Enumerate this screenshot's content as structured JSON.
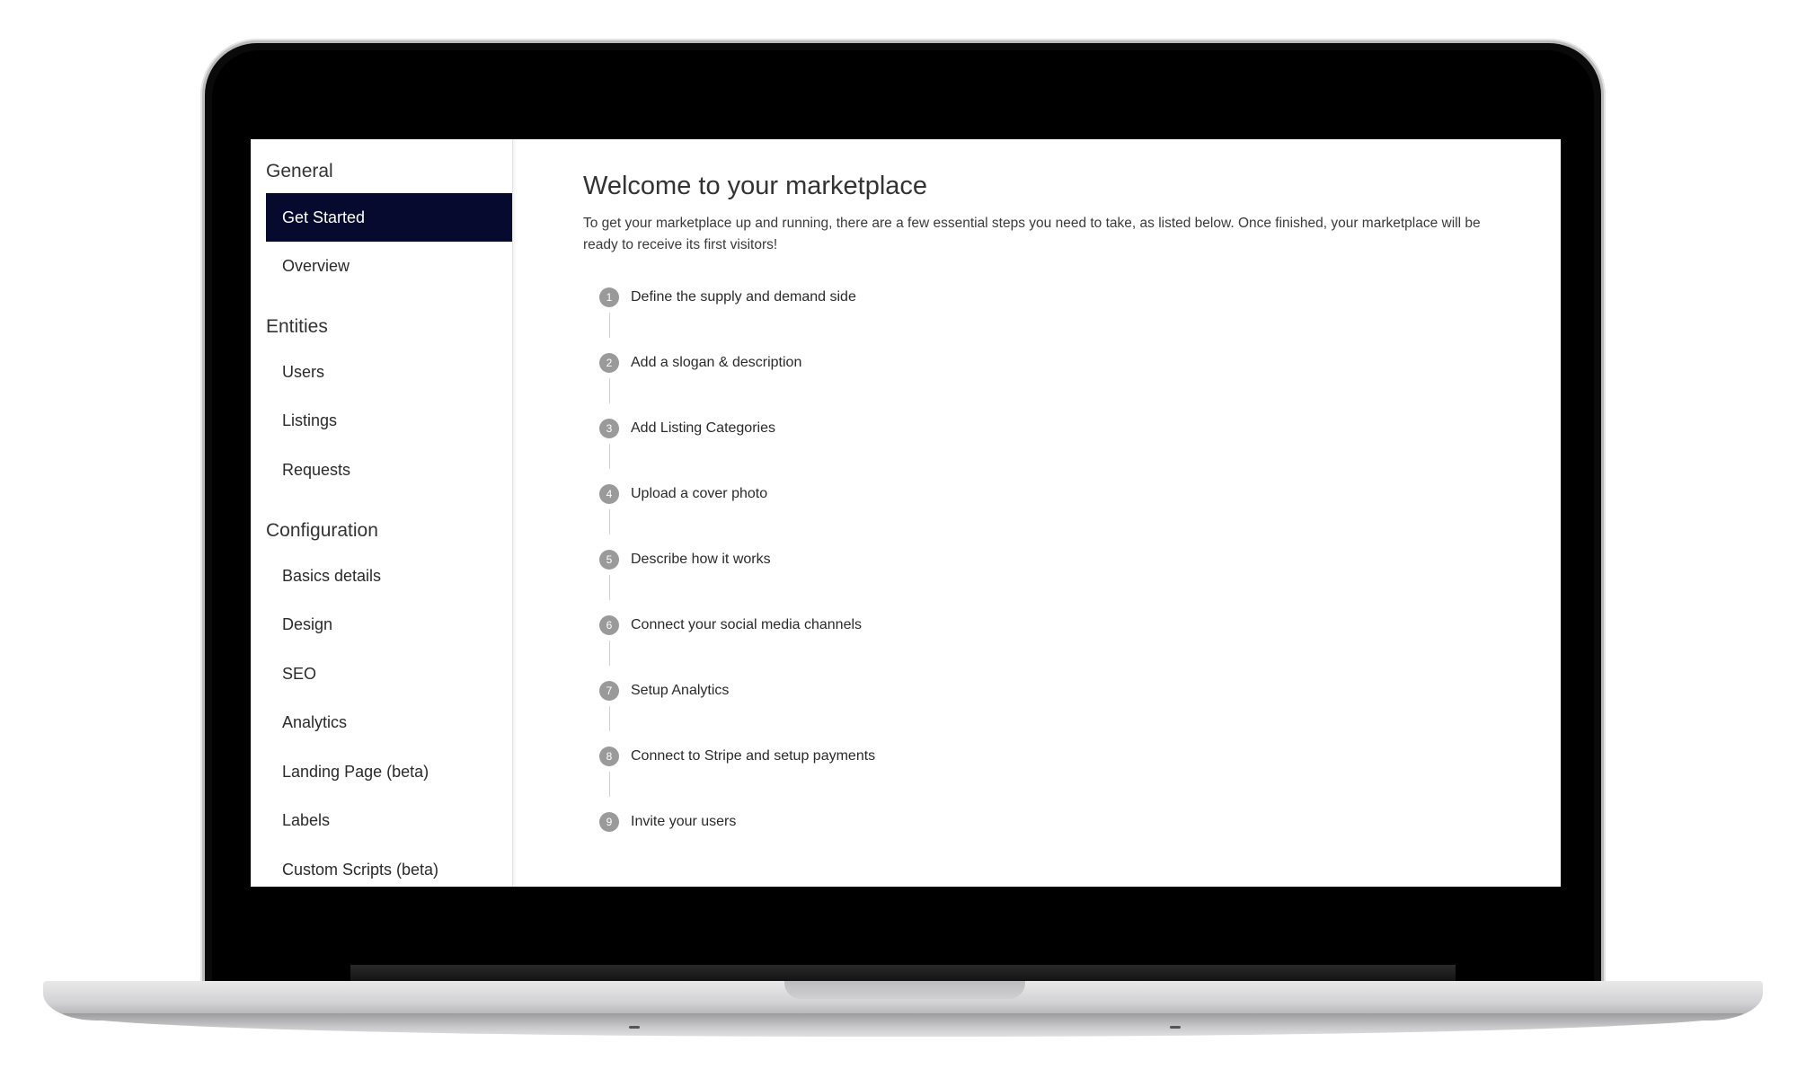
{
  "sidebar": {
    "sections": [
      {
        "title": "General",
        "items": [
          "Get Started",
          "Overview"
        ]
      },
      {
        "title": "Entities",
        "items": [
          "Users",
          "Listings",
          "Requests"
        ]
      },
      {
        "title": "Configuration",
        "items": [
          "Basics details",
          "Design",
          "SEO",
          "Analytics",
          "Landing Page (beta)",
          "Labels",
          "Custom Scripts (beta)"
        ]
      }
    ],
    "active_item": "Get Started"
  },
  "main": {
    "title": "Welcome to your marketplace",
    "intro": "To get your marketplace up and running, there are a few essential steps you need to take, as listed below. Once finished, your marketplace will be ready to receive its first visitors!",
    "steps": [
      {
        "number": "1",
        "label": "Define the supply and demand side"
      },
      {
        "number": "2",
        "label": "Add a slogan & description"
      },
      {
        "number": "3",
        "label": "Add Listing Categories"
      },
      {
        "number": "4",
        "label": "Upload a cover photo"
      },
      {
        "number": "5",
        "label": "Describe how it works"
      },
      {
        "number": "6",
        "label": "Connect your social media channels"
      },
      {
        "number": "7",
        "label": "Setup Analytics"
      },
      {
        "number": "8",
        "label": "Connect to Stripe and setup payments"
      },
      {
        "number": "9",
        "label": "Invite your users"
      }
    ]
  },
  "colors": {
    "active_nav_bg": "#060a2e",
    "step_badge": "#9a9a9a",
    "laptop_bezel": "#000000"
  }
}
